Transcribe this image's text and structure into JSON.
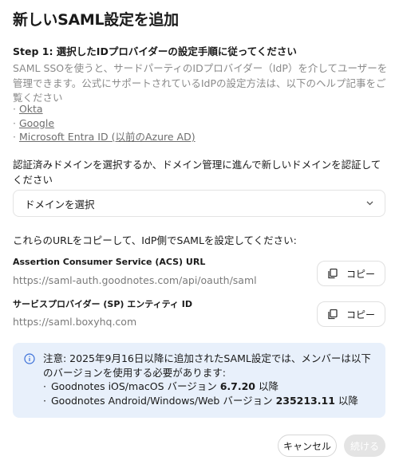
{
  "dialog": {
    "title": "新しいSAML設定を追加",
    "step_heading": "Step 1: 選択したIDプロバイダーの設定手順に従ってください",
    "description": "SAML SSOを使うと、サードパーティのIDプロバイダー（IdP）を介してユーザーを管理できます。公式にサポートされているIdPの設定方法は、以下のヘルプ記事をご覧ください",
    "links": [
      "Okta",
      "Google",
      "Microsoft Entra ID (以前のAzure AD)"
    ],
    "domain_label": "認証済みドメインを選択するか、ドメイン管理に進んで新しいドメインを認証してください",
    "domain_select": {
      "value": "ドメインを選択"
    },
    "copy_instructions": "これらのURLをコピーして、IdP側でSAMLを設定してください:",
    "acs": {
      "title": "Assertion Consumer Service (ACS) URL",
      "url": "https://saml-auth.goodnotes.com/api/oauth/saml",
      "copy_label": "コピー"
    },
    "sp": {
      "title": "サービスプロバイダー (SP) エンティティ ID",
      "url": "https://saml.boxyhq.com",
      "copy_label": "コピー"
    },
    "notice": {
      "text": "注意: 2025年9月16日以降に追加されたSAML設定では、メンバーは以下のバージョンを使用する必要があります:",
      "items": [
        {
          "prefix": "Goodnotes iOS/macOS バージョン ",
          "version": "6.7.20",
          "suffix": " 以降"
        },
        {
          "prefix": "Goodnotes Android/Windows/Web バージョン ",
          "version": "235213.11",
          "suffix": " 以降"
        }
      ]
    },
    "buttons": {
      "cancel": "キャンセル",
      "next": "続ける"
    }
  },
  "colors": {
    "notice_bg": "#e8f0fb",
    "info_icon": "#3a6fd8",
    "disabled_button": "#e4e4e4"
  }
}
